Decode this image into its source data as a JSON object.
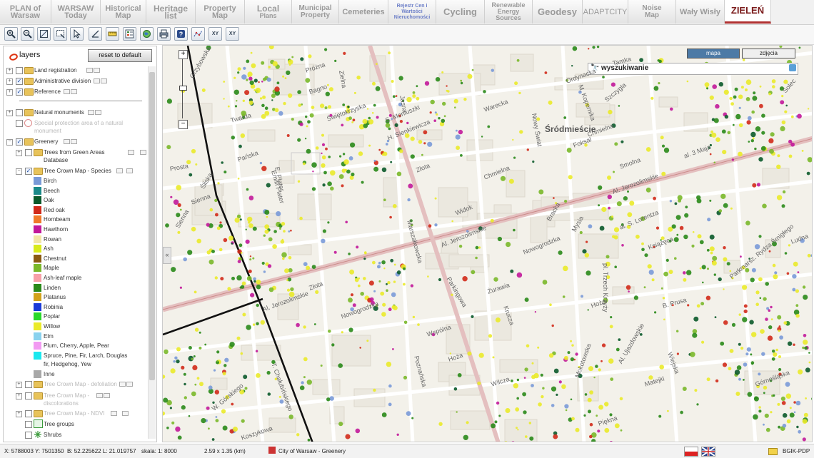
{
  "nav": {
    "tabs": [
      {
        "l1": "PLAN of",
        "l2": "Warsaw"
      },
      {
        "l1": "WARSAW",
        "l2": "Today"
      },
      {
        "l1": "Historical",
        "l2": "Map"
      },
      {
        "l1": "Heritage",
        "l2": "list"
      },
      {
        "l1": "Property",
        "l2": "Map"
      },
      {
        "l1": "Local",
        "l2": "Plans"
      },
      {
        "l1": "Municipal",
        "l2": "Property"
      },
      {
        "l1": "Cemeteries",
        "l2": ""
      },
      {
        "l1": "Rejestr Cen i Wartości",
        "l2": "Nieruchomości"
      },
      {
        "l1": "Cycling",
        "l2": ""
      },
      {
        "l1": "Renewable Energy",
        "l2": "Sources"
      },
      {
        "l1": "Geodesy",
        "l2": ""
      },
      {
        "l1": "ADAPTCITY",
        "l2": ""
      },
      {
        "l1": "Noise",
        "l2": "Map"
      },
      {
        "l1": "Wały Wisły",
        "l2": ""
      },
      {
        "l1": "ZIELEŃ",
        "l2": ""
      }
    ]
  },
  "toolbar": {
    "tools": [
      "zoom-in-tool",
      "zoom-out-tool",
      "zoom-extent-tool",
      "zoom-box-tool",
      "select-tool",
      "measure-length-tool",
      "legend-tool",
      "identify-tool",
      "globe-tool",
      "print-tool",
      "help-tool",
      "route-tool",
      "xy-coordinates-tool",
      "xy-search-tool"
    ],
    "xy1": "XY",
    "xy2": "XY"
  },
  "layers": {
    "title": "layers",
    "reset_label": "reset to default",
    "groups": {
      "land": "Land registration",
      "admin": "Administrative division",
      "reference": "Reference",
      "natural": "Natural monuments",
      "special": "Special protection area of a natural",
      "special2": "monument",
      "greenery": "Greenery",
      "trees_db": "Trees from Green Areas",
      "trees_db2": "Database",
      "crown_species": "Tree Crown Map - Species",
      "crown_defol": "Tree Crown Map - defoliation",
      "crown_discol": "Tree Crown Map -",
      "crown_discol2": "discolorations",
      "crown_ndvi": "Tree Crown Map - NDVI",
      "tree_groups": "Tree groups",
      "shrubs": "Shrubs"
    },
    "species": [
      {
        "label": "Birch",
        "color": "#7a9ad8"
      },
      {
        "label": "Beech",
        "color": "#1b8a8a"
      },
      {
        "label": "Oak",
        "color": "#0b5a2b"
      },
      {
        "label": "Red oak",
        "color": "#d12a1a"
      },
      {
        "label": "Hornbeam",
        "color": "#f07a2a"
      },
      {
        "label": "Hawthorn",
        "color": "#c2189a"
      },
      {
        "label": "Rowan",
        "color": "#f2e6a6"
      },
      {
        "label": "Ash",
        "color": "#d8ea1a"
      },
      {
        "label": "Chestnut",
        "color": "#8a5a12"
      },
      {
        "label": "Maple",
        "color": "#7ab82a"
      },
      {
        "label": "Ash-leaf maple",
        "color": "#f7a0a8"
      },
      {
        "label": "Linden",
        "color": "#2a8a1a"
      },
      {
        "label": "Platanus",
        "color": "#d2a21a"
      },
      {
        "label": "Robinia",
        "color": "#1a3ad8"
      },
      {
        "label": "Poplar",
        "color": "#2ad82a"
      },
      {
        "label": "Willow",
        "color": "#eaea2a"
      },
      {
        "label": "Elm",
        "color": "#8ad2ee"
      },
      {
        "label": "Plum, Cherry, Apple, Pear",
        "color": "#f29af2"
      },
      {
        "label": "Spruce, Pine, Fir, Larch, Douglas",
        "label2": "fir, Hedgehog, Yew",
        "color": "#1ae8ee"
      },
      {
        "label": "Inne",
        "color": "#a8a8a8"
      }
    ]
  },
  "map": {
    "btn_mapa": "mapa",
    "btn_zdjecia": "zdjęcia",
    "search_label": "wyszukiwanie",
    "district": "Śródmieście",
    "streets": [
      {
        "t": "Grzybowska"
      },
      {
        "t": "Próżna"
      },
      {
        "t": "Zielna"
      },
      {
        "t": "Sienna"
      },
      {
        "t": "Bagno"
      },
      {
        "t": "Twarda"
      },
      {
        "t": "Świętokrzyska"
      },
      {
        "t": "S. Moniuszki"
      },
      {
        "t": "Jasna"
      },
      {
        "t": "Tamka"
      },
      {
        "t": "Ordynacka"
      },
      {
        "t": "M. Kopernika"
      },
      {
        "t": "Szczygla"
      },
      {
        "t": "Solec"
      },
      {
        "t": "Warecka"
      },
      {
        "t": "Nowy Świat"
      },
      {
        "t": "Foksal"
      },
      {
        "t": "H. Sienkiewicza"
      },
      {
        "t": "Złota"
      },
      {
        "t": "Chmielna"
      },
      {
        "t": "al. 3 Maja"
      },
      {
        "t": "Smolna"
      },
      {
        "t": "Al. Jerozolimskie"
      },
      {
        "t": "Prosta"
      },
      {
        "t": "Pańska"
      },
      {
        "t": "Śliska"
      },
      {
        "t": "Marszałkowska"
      },
      {
        "t": "Widok"
      },
      {
        "t": "Bracka"
      },
      {
        "t": "Mysia"
      },
      {
        "t": "Al. Jerozolimskie"
      },
      {
        "t": "Nowogrodzka"
      },
      {
        "t": "al. S. Lorentza"
      },
      {
        "t": "Książęca"
      },
      {
        "t": "Ludna"
      },
      {
        "t": "Chmielna"
      },
      {
        "t": "E. Plater"
      },
      {
        "t": "Al. Jerozolimskie"
      },
      {
        "t": "Nowogrodzka"
      },
      {
        "t": "Żurawia"
      },
      {
        "t": "Krucza"
      },
      {
        "t": "Hoża"
      },
      {
        "t": "B. Prusa"
      },
      {
        "t": "Wspólna"
      },
      {
        "t": "Poznańska"
      },
      {
        "t": "Hoża"
      },
      {
        "t": "Wilcza"
      },
      {
        "t": "Al. Ujazdowskie"
      },
      {
        "t": "Matejki"
      },
      {
        "t": "Górnośląska"
      },
      {
        "t": "Piękna"
      },
      {
        "t": "Koszykowa"
      },
      {
        "t": "W. Górskiego"
      },
      {
        "t": "T. Chałubińskiego"
      },
      {
        "t": "pl. Trzech Krzyży"
      },
      {
        "t": "Parkmarsz. Rydza Śmigłego"
      },
      {
        "t": "Wiejska"
      },
      {
        "t": "Mokotowska"
      },
      {
        "t": "Złota"
      },
      {
        "t": "Sienna"
      },
      {
        "t": "Emilii Plater"
      },
      {
        "t": "Parkingowa"
      }
    ]
  },
  "status": {
    "coords": "X: 5788003  Y: 7501350",
    "latlon": "B: 52.225622  L: 21.019757",
    "scale": "skala:  1: 8000",
    "extent": "2.59 x 1.35 (km)",
    "city": "City of Warsaw - Greenery",
    "brand": "BGIK-PDP"
  }
}
